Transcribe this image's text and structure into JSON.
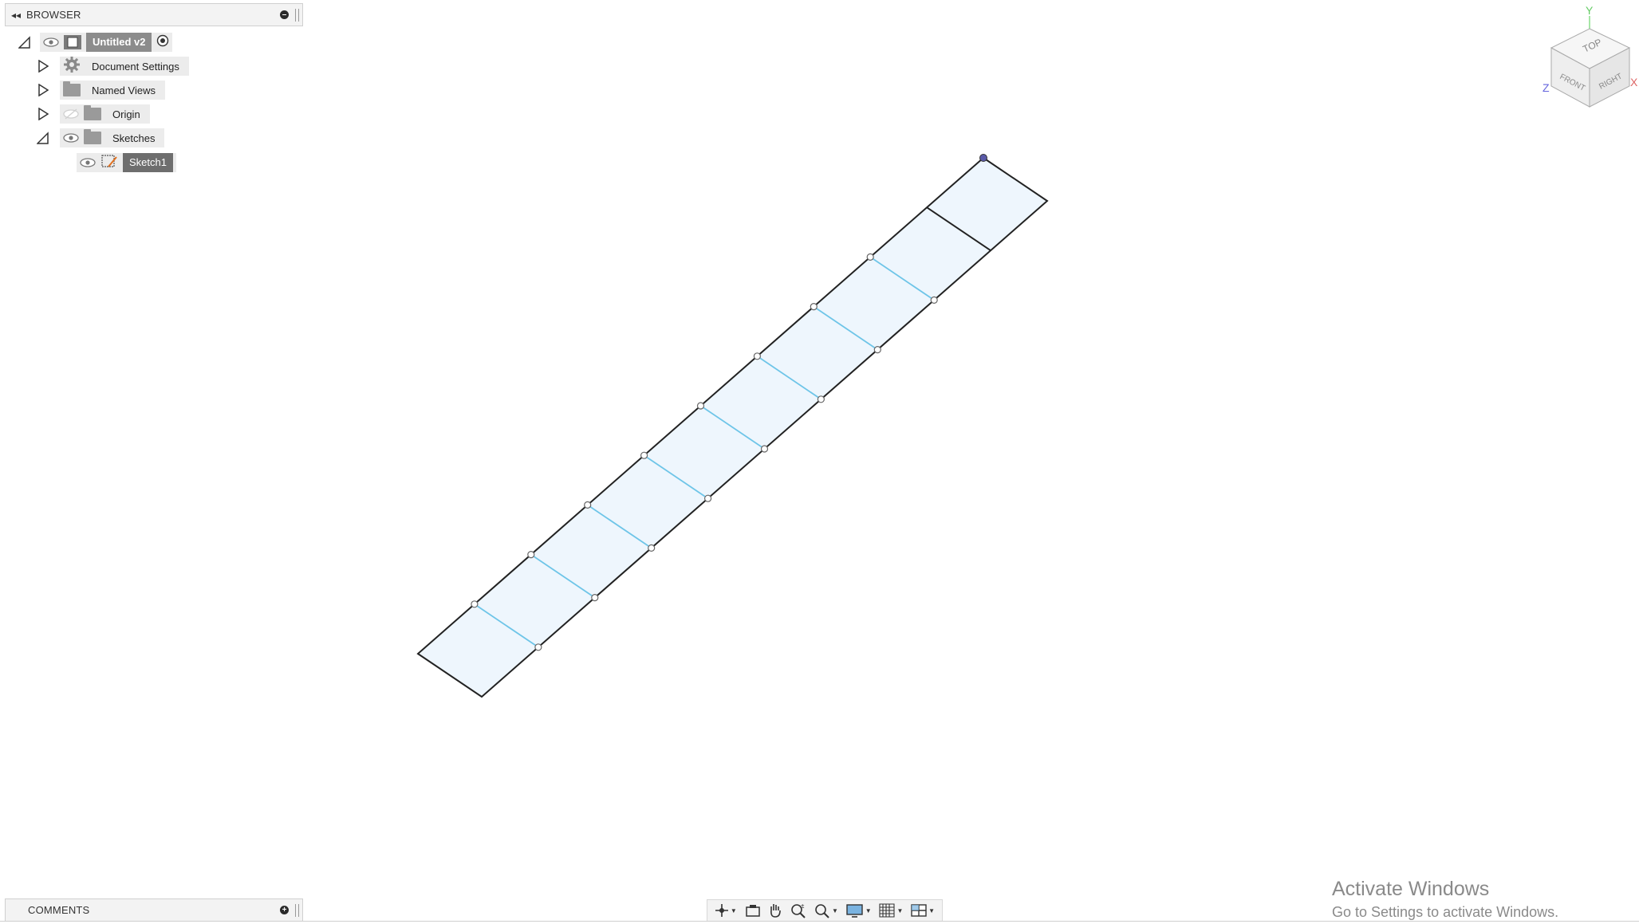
{
  "browser": {
    "title": "BROWSER",
    "tree": [
      {
        "label": "Untitled v2",
        "icon": "component-icon",
        "expanded": true
      },
      {
        "label": "Document Settings",
        "icon": "gear-icon",
        "expanded": false
      },
      {
        "label": "Named Views",
        "icon": "folder-icon",
        "expanded": false
      },
      {
        "label": "Origin",
        "icon": "folder-icon",
        "expanded": false,
        "hidden": true
      },
      {
        "label": "Sketches",
        "icon": "folder-icon",
        "expanded": true
      },
      {
        "label": "Sketch1",
        "icon": "sketch-icon",
        "selected": true
      }
    ]
  },
  "comments": {
    "title": "COMMENTS"
  },
  "viewcube": {
    "faces": [
      "TOP",
      "FRONT",
      "RIGHT"
    ],
    "axes": [
      "Y",
      "Z",
      "X"
    ]
  },
  "sketch": {
    "cells": 10,
    "divider_color": "#6ec5e8",
    "outline_color": "#222222",
    "fill_color": "#eef6fd"
  },
  "navbar": {
    "tools": [
      "orbit-icon",
      "look-at-icon",
      "pan-icon",
      "zoom-icon",
      "zoom-window-icon",
      "display-settings-icon",
      "grid-icon",
      "viewports-icon"
    ]
  },
  "watermark": {
    "title": "Activate Windows",
    "subtitle": "Go to Settings to activate Windows."
  }
}
